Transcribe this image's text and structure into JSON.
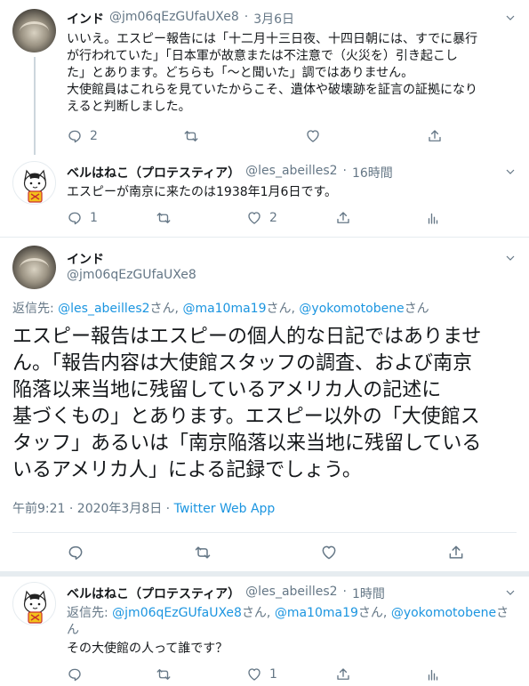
{
  "tweet1": {
    "name": "インド",
    "handle": "@jm06qEzGUfaUXe8",
    "sep": "·",
    "date": "3月6日",
    "lines": [
      "いいえ。エスピー報告には「十二月十三日夜、十四日朝には、すでに暴行",
      "が行われていた」「日本軍が故意または不注意で（火災を）引き起こし",
      "た」とあります。どちらも「〜と聞いた」調ではありません。",
      "大使館員はこれらを見ていたからこそ、遺体や破壊跡を証言の証拠になり",
      "えると判断しました。"
    ],
    "reply_count": "2",
    "like_count": ""
  },
  "tweet2": {
    "name": "ベルはねこ（プロテスティア）",
    "handle": "@les_abeilles2",
    "sep": "·",
    "time": "16時間",
    "text": "エスピーが南京に来たのは1938年1月6日です。",
    "reply_count": "1",
    "like_count": "2"
  },
  "main": {
    "name": "インド",
    "handle": "@jm06qEzGUfaUXe8",
    "reply_prefix": "返信先: ",
    "reply_to_1": "@les_abeilles2",
    "reply_san_1": "さん, ",
    "reply_to_2": "@ma10ma19",
    "reply_san_2": "さん, ",
    "reply_to_3": "@yokomotobene",
    "reply_san_3": "さん",
    "lines": [
      "エスピー報告はエスピーの個人的な日記ではありませ",
      "ん。「報告内容は大使館スタッフの調査、および南京",
      "陥落以来当地に残留しているアメリカ人の記述に",
      "基づくもの」とあります。エスピー以外の「大使館ス",
      "タッフ」あるいは「南京陥落以来当地に残留している",
      "いるアメリカ人」による記録でしょう。"
    ],
    "meta_time": "午前9:21 · 2020年3月8日 · ",
    "meta_source": "Twitter Web App"
  },
  "tweet3": {
    "name": "ベルはねこ（プロテスティア）",
    "handle": "@les_abeilles2",
    "sep": "·",
    "time": "1時間",
    "reply_prefix": "返信先: ",
    "reply_to_1": "@jm06qEzGUfaUXe8",
    "reply_san_1": "さん, ",
    "reply_to_2": "@ma10ma19",
    "reply_san_2": "さん, ",
    "reply_to_3": "@yokomotobene",
    "reply_san_3": "さ",
    "reply_line2": "ん",
    "text": "その大使館の人って誰です？",
    "reply_count": "",
    "like_count": "1"
  },
  "icons": {
    "reply": "reply-icon",
    "retweet": "retweet-icon",
    "like": "heart-icon",
    "share": "share-icon",
    "analytics": "analytics-icon",
    "more": "chevron-down-icon"
  },
  "colors": {
    "link": "#1b95e0",
    "muted": "#657786",
    "text": "#14171a",
    "divider": "#e6ecf0"
  }
}
